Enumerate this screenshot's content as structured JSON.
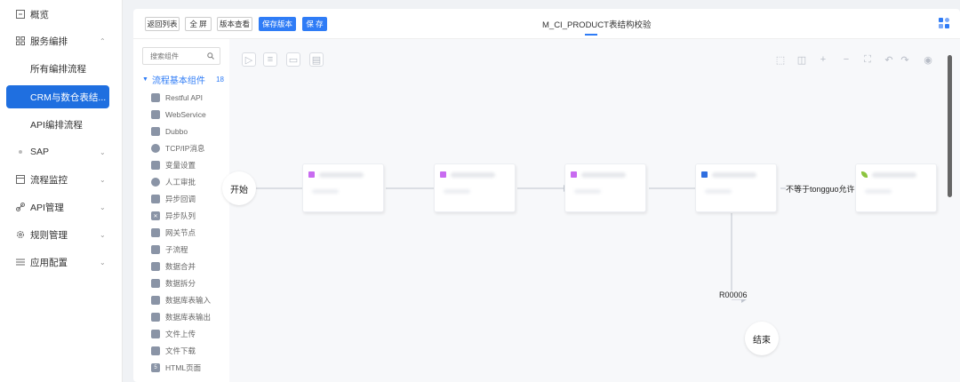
{
  "nav": {
    "items": [
      {
        "label": "概览",
        "icon": "overview-icon"
      },
      {
        "label": "服务编排",
        "icon": "grid-icon"
      },
      {
        "label": "所有编排流程"
      },
      {
        "label": "CRM与数仓表结..."
      },
      {
        "label": "API编排流程"
      },
      {
        "label": "SAP"
      },
      {
        "label": "流程监控",
        "icon": "monitor-icon"
      },
      {
        "label": "API管理",
        "icon": "link-icon"
      },
      {
        "label": "规则管理",
        "icon": "gear-icon"
      },
      {
        "label": "应用配置",
        "icon": "list-icon"
      }
    ]
  },
  "toolbar": {
    "back": "返回列表",
    "fullscreen": "全 屏",
    "version_view": "版本查看",
    "save_version": "保存版本",
    "save": "保 存",
    "title": "M_CI_PRODUCT表结构校验"
  },
  "components": {
    "search_placeholder": "搜索组件",
    "group_label": "流程基本组件",
    "group_count": "18",
    "items": [
      "Restful API",
      "WebService",
      "Dubbo",
      "TCP/IP消息",
      "变量设置",
      "人工审批",
      "异步回调",
      "异步队列",
      "网关节点",
      "子流程",
      "数据合并",
      "数据拆分",
      "数据库表输入",
      "数据库表输出",
      "文件上传",
      "文件下载",
      "HTML页面"
    ]
  },
  "canvas": {
    "start": "开始",
    "end": "结束",
    "edge_label_1": "不等于tongguo允许",
    "edge_label_2": "R00006"
  },
  "colors": {
    "primary": "#2f7cf6",
    "tag_purple": "#c86bf0",
    "tag_blue": "#2f6fe0",
    "tag_green": "#8cc43f"
  }
}
